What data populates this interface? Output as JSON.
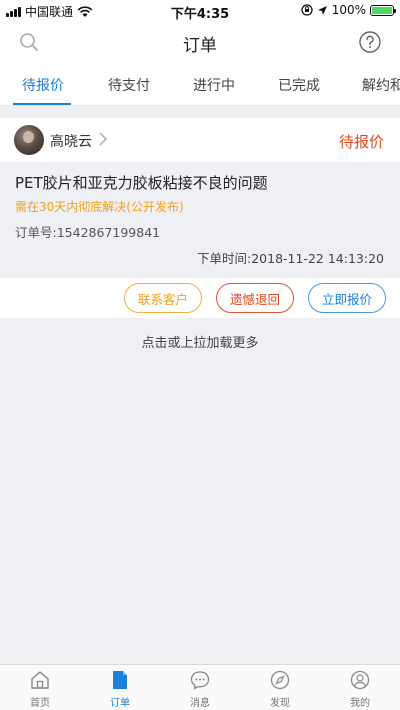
{
  "status_bar": {
    "carrier": "中国联通",
    "time": "下午4:35",
    "battery": "100%",
    "battery_level": 1.0
  },
  "header": {
    "title": "订单",
    "left_icon": "search-icon",
    "right_icon": "help-icon"
  },
  "tabs": [
    {
      "label": "待报价",
      "active": true
    },
    {
      "label": "待支付",
      "active": false
    },
    {
      "label": "进行中",
      "active": false
    },
    {
      "label": "已完成",
      "active": false
    },
    {
      "label": "解约和",
      "active": false
    }
  ],
  "order": {
    "user_name": "高晓云",
    "status": "待报价",
    "title": "PET胶片和亚克力胶板粘接不良的问题",
    "note": "需在30天内彻底解决(公开发布)",
    "order_no": "订单号:1542867199841",
    "order_time": "下单时间:2018-11-22 14:13:20",
    "actions": {
      "contact": "联系客户",
      "return": "遗憾退回",
      "quote": "立即报价"
    }
  },
  "load_more": "点击或上拉加载更多",
  "bottom_nav": [
    {
      "label": "首页",
      "icon": "home-icon",
      "active": false
    },
    {
      "label": "订单",
      "icon": "order-icon",
      "active": true
    },
    {
      "label": "消息",
      "icon": "message-icon",
      "active": false
    },
    {
      "label": "发现",
      "icon": "compass-icon",
      "active": false
    },
    {
      "label": "我的",
      "icon": "profile-icon",
      "active": false
    }
  ],
  "colors": {
    "accent": "#1c7fd8",
    "status_red": "#e64a19",
    "note_orange": "#f0a020"
  }
}
